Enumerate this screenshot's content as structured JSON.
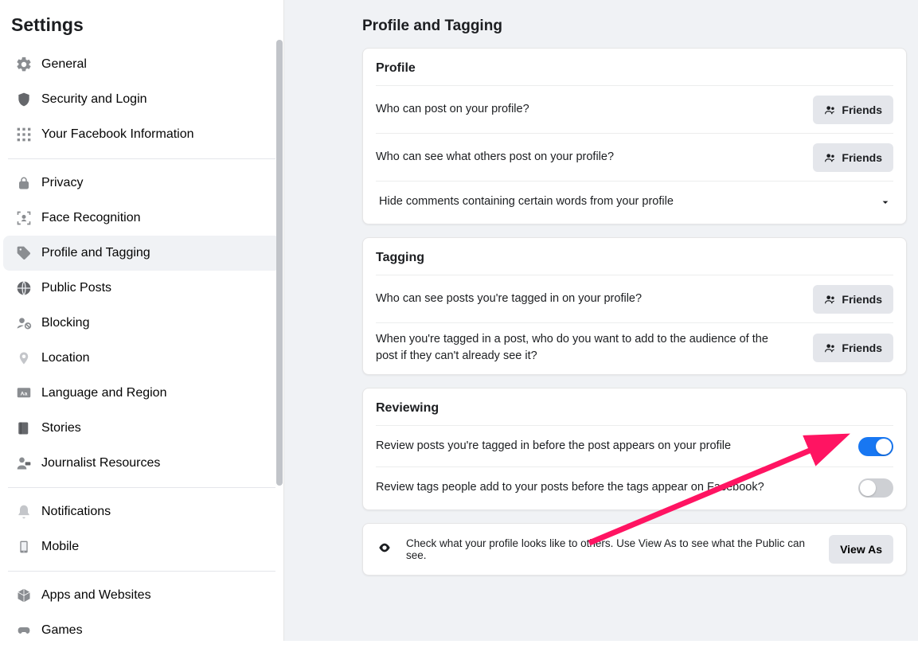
{
  "sidebar": {
    "title": "Settings",
    "groups": [
      [
        "General",
        "Security and Login",
        "Your Facebook Information"
      ],
      [
        "Privacy",
        "Face Recognition",
        "Profile and Tagging",
        "Public Posts",
        "Blocking",
        "Location",
        "Language and Region",
        "Stories",
        "Journalist Resources"
      ],
      [
        "Notifications",
        "Mobile"
      ],
      [
        "Apps and Websites",
        "Games"
      ]
    ],
    "active": "Profile and Tagging"
  },
  "page": {
    "title": "Profile and Tagging"
  },
  "profile_section": {
    "title": "Profile",
    "rows": {
      "post": {
        "label": "Who can post on your profile?",
        "value": "Friends"
      },
      "see_others": {
        "label": "Who can see what others post on your profile?",
        "value": "Friends"
      },
      "hide_comments": {
        "label": "Hide comments containing certain words from your profile"
      }
    }
  },
  "tagging_section": {
    "title": "Tagging",
    "rows": {
      "see_tagged": {
        "label": "Who can see posts you're tagged in on your profile?",
        "value": "Friends"
      },
      "add_audience": {
        "label": "When you're tagged in a post, who do you want to add to the audience of the post if they can't already see it?",
        "value": "Friends"
      }
    }
  },
  "reviewing_section": {
    "title": "Reviewing",
    "rows": {
      "review_posts": {
        "label": "Review posts you're tagged in before the post appears on your profile",
        "on": true
      },
      "review_tags": {
        "label": "Review tags people add to your posts before the tags appear on Facebook?",
        "on": false
      }
    }
  },
  "viewas": {
    "text": "Check what your profile looks like to others. Use View As to see what the Public can see.",
    "button": "View As"
  },
  "colors": {
    "accent": "#1877f2",
    "arrow": "#ff1462"
  }
}
